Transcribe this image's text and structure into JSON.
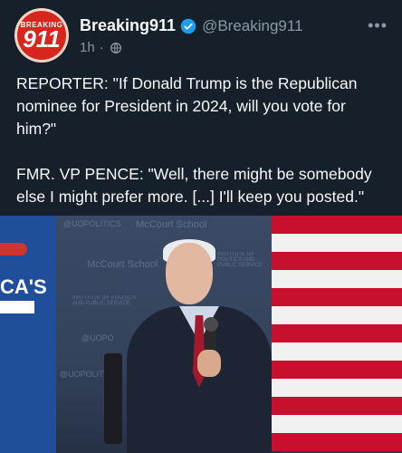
{
  "post": {
    "avatar_top_text": "BREAKING",
    "avatar_number": "911",
    "display_name": "Breaking911",
    "handle": "@Breaking911",
    "time": "1h",
    "separator": "·",
    "more_label": "•••",
    "text": "REPORTER: \"If Donald Trump is the Republican nominee for President in 2024, will you vote for him?\"\n\nFMR. VP PENCE: \"Well, there might be somebody else I might prefer more. [...] I'll keep you posted.\""
  },
  "media": {
    "backdrop_logos": [
      "@UOPOLITICS",
      "McCourt School",
      "INSTITUTE OF POLITICS AND PUBLIC SERVICE",
      "McCourt School",
      "INSTITUTE OF POLITICS AND PUBLIC SERVICE",
      "@UOPO",
      "@UOPOLITICS"
    ],
    "panel_text": "CA'S"
  },
  "colors": {
    "background": "#15202b",
    "verified": "#1d9bf0",
    "secondary_text": "#8b98a5"
  },
  "icons": [
    "verified-badge-icon",
    "globe-icon",
    "more-options-icon"
  ]
}
